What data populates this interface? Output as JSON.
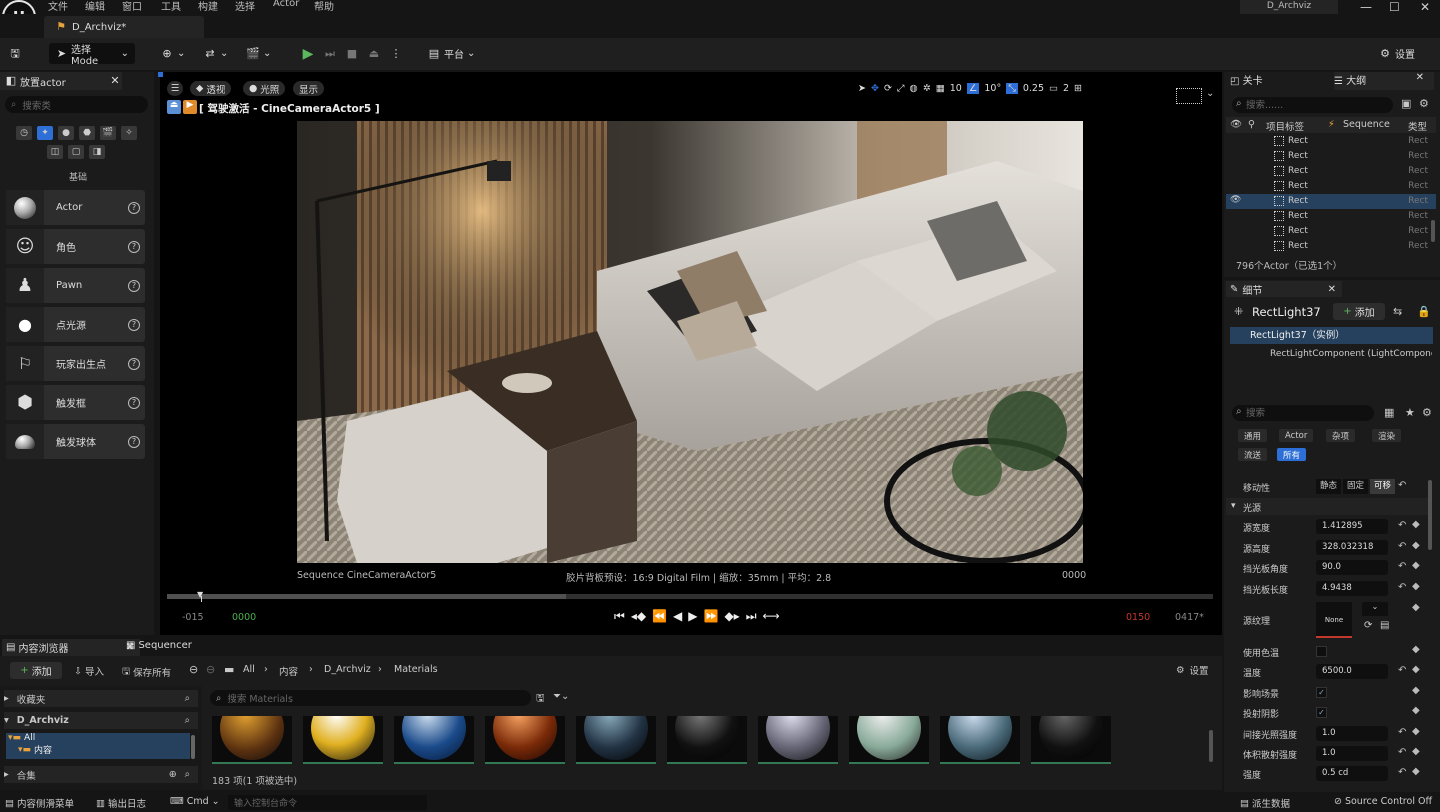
{
  "app": {
    "logo": "U",
    "menu": [
      "文件",
      "编辑",
      "窗口",
      "工具",
      "构建",
      "选择",
      "Actor",
      "帮助"
    ],
    "project": "D_Archviz",
    "doc_tab": "D_Archviz*"
  },
  "toolbar": {
    "mode": "选择 Mode",
    "platform": "平台",
    "settings": "设置"
  },
  "place_actors": {
    "tab": "放置actor",
    "search_placeholder": "搜索类",
    "category": "基础",
    "items": [
      {
        "label": "Actor"
      },
      {
        "label": "角色"
      },
      {
        "label": "Pawn"
      },
      {
        "label": "点光源"
      },
      {
        "label": "玩家出生点"
      },
      {
        "label": "触发框"
      },
      {
        "label": "触发球体"
      }
    ]
  },
  "viewport": {
    "view_mode": "透视",
    "lit": "光照",
    "show": "显示",
    "camera_label": "[ 驾驶激活 - CineCameraActor5 ]",
    "grid": "10",
    "rot": "10°",
    "scale": "0.25",
    "cam_speed": "2",
    "overlay_left": "Sequence CineCameraActor5",
    "overlay_mid": "胶片背板预设：16:9 Digital Film | 缩放：35mm | 平均：2.8",
    "overlay_right": "0000",
    "time_start": "-015",
    "time_cur": "0000",
    "time_end": "0150",
    "time_total": "0417*",
    "scrub_progress": 0.38
  },
  "outliner": {
    "tab1": "关卡",
    "tab2": "大纲",
    "search_placeholder": "搜索......",
    "col_label": "项目标签",
    "col_seq": "Sequence",
    "col_type": "类型",
    "rows": [
      {
        "name": "Rect",
        "type": "Rect"
      },
      {
        "name": "Rect",
        "type": "Rect"
      },
      {
        "name": "Rect",
        "type": "Rect"
      },
      {
        "name": "Rect",
        "type": "Rect"
      },
      {
        "name": "Rect",
        "type": "Rect",
        "selected": true
      },
      {
        "name": "Rect",
        "type": "Rect"
      },
      {
        "name": "Rect",
        "type": "Rect"
      },
      {
        "name": "Rect",
        "type": "Rect"
      }
    ],
    "count": "796个Actor（已选1个）"
  },
  "details": {
    "tab": "细节",
    "title": "RectLight37",
    "add": "添加",
    "component_root": "RectLight37（实例）",
    "component_child": "RectLightComponent (LightComponent)",
    "search_placeholder": "搜索",
    "filters": [
      "通用",
      "Actor",
      "杂项",
      "渲染",
      "流送",
      "所有"
    ],
    "mobility_label": "移动性",
    "mobility": [
      "静态",
      "固定",
      "可移"
    ],
    "section": "光源",
    "props": [
      {
        "label": "源宽度",
        "value": "1.412895"
      },
      {
        "label": "源高度",
        "value": "328.032318"
      },
      {
        "label": "挡光板角度",
        "value": "90.0"
      },
      {
        "label": "挡光板长度",
        "value": "4.9438"
      }
    ],
    "texture_label": "源纹理",
    "texture_value": "None",
    "props2": [
      {
        "label": "使用色温",
        "value": ""
      },
      {
        "label": "温度",
        "value": "6500.0"
      },
      {
        "label": "影响场景",
        "value": "✓"
      },
      {
        "label": "投射阴影",
        "value": "✓"
      },
      {
        "label": "间接光照强度",
        "value": "1.0"
      },
      {
        "label": "体积散射强度",
        "value": "1.0"
      },
      {
        "label": "强度",
        "value": "0.5 cd"
      }
    ]
  },
  "content_browser": {
    "tab": "内容浏览器",
    "tab2": "Sequencer",
    "add": "添加",
    "import": "导入",
    "save_all": "保存所有",
    "crumbs": [
      "All",
      "内容",
      "D_Archviz",
      "Materials"
    ],
    "settings": "设置",
    "favorites": "收藏夹",
    "project": "D_Archviz",
    "tree": [
      "All",
      "内容"
    ],
    "collections": "合集",
    "search_placeholder": "搜索 Materials",
    "count": "183 项(1 项被选中)"
  },
  "statusbar": {
    "drawer": "内容侧滑菜单",
    "output": "输出日志",
    "cmd": "Cmd",
    "console_placeholder": "输入控制台命令",
    "derived": "派生数据",
    "source_control": "Source Control Off"
  },
  "colors": {
    "accent": "#2d6fd6",
    "play": "#5cb85c",
    "selection": "#26415e",
    "time_red": "#c0392b",
    "time_green": "#4caf50"
  }
}
